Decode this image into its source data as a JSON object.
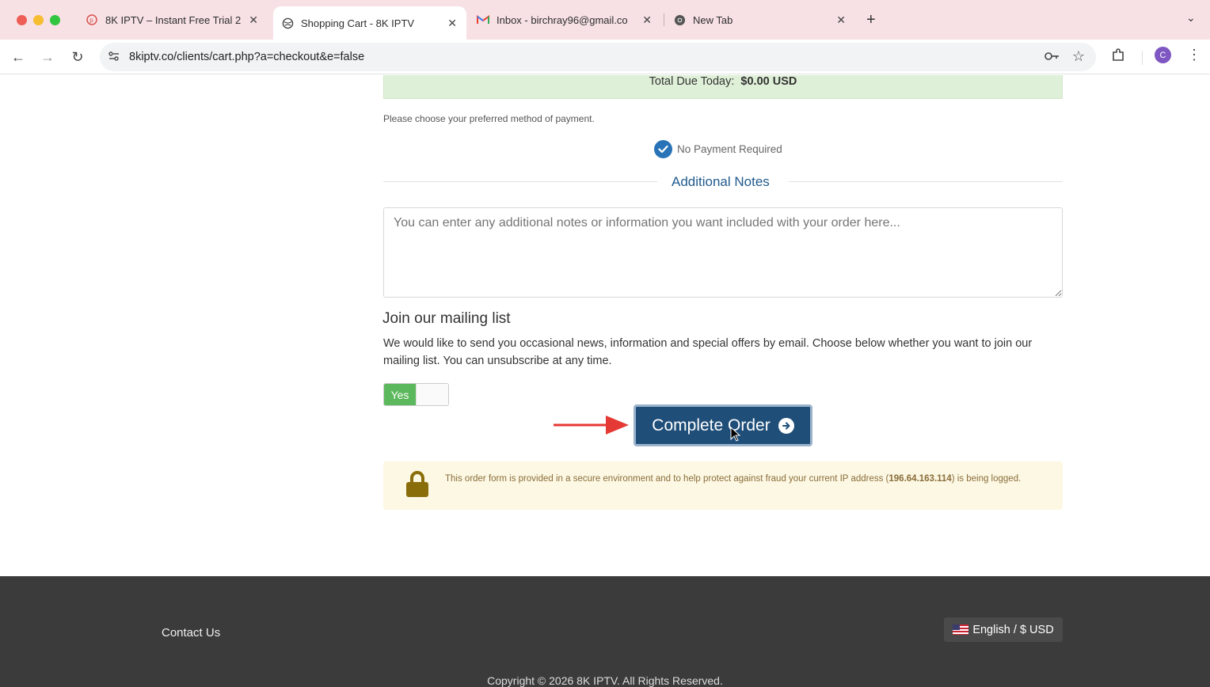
{
  "browser": {
    "tabs": [
      {
        "label": "8K IPTV – Instant Free Trial 2",
        "icon": "p-circle-icon"
      },
      {
        "label": "Shopping Cart - 8K IPTV",
        "icon": "globe-icon"
      },
      {
        "label": "Inbox - birchray96@gmail.co",
        "icon": "gmail-icon"
      },
      {
        "label": "New Tab",
        "icon": "chrome-icon"
      }
    ],
    "url": "8kiptv.co/clients/cart.php?a=checkout&e=false",
    "avatar_letter": "C"
  },
  "checkout": {
    "total_label": "Total Due Today:",
    "total_value": "$0.00 USD",
    "payment_hint": "Please choose your preferred method of payment.",
    "no_payment": "No Payment Required",
    "notes_title": "Additional Notes",
    "notes_placeholder": "You can enter any additional notes or information you want included with your order here...",
    "mailing_title": "Join our mailing list",
    "mailing_text": "We would like to send you occasional news, information and special offers by email. Choose below whether you want to join our mailing list. You can unsubscribe at any time.",
    "toggle_label": "Yes",
    "complete_button": "Complete Order",
    "secure_text_pre": "This order form is provided in a secure environment and to help protect against fraud your current IP address (",
    "ip_address": "196.64.163.114",
    "secure_text_post": ") is being logged."
  },
  "footer": {
    "contact": "Contact Us",
    "language": "English / $ USD",
    "copyright": "Copyright © 2026 8K IPTV. All Rights Reserved."
  },
  "colors": {
    "primary_button": "#1f4e79",
    "toggle_on": "#5cb85c",
    "annotation_arrow": "#e53935"
  }
}
